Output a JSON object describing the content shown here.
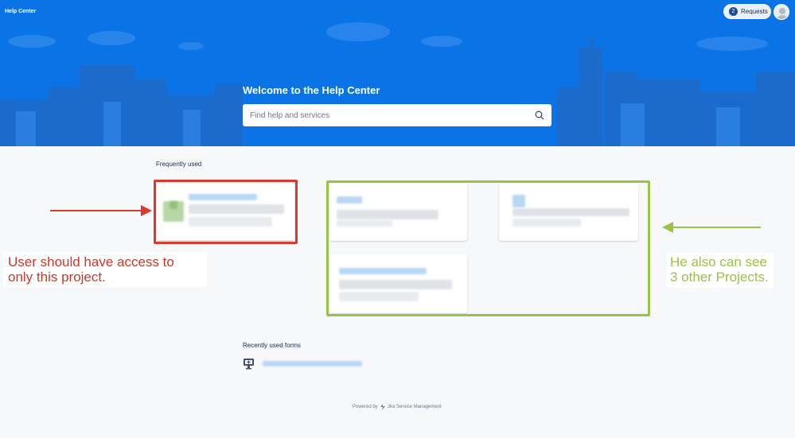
{
  "header": {
    "brand": "Help Center",
    "requests_count": "2",
    "requests_label": "Requests"
  },
  "hero": {
    "welcome": "Welcome to the Help Center",
    "search_placeholder": "Find help and services"
  },
  "sections": {
    "frequently_used": "Frequently used",
    "recently_used_forms": "Recently used forms"
  },
  "annotations": {
    "red": "User should have access to only this project.",
    "green": "He also can see 3 other Projects."
  },
  "footer": {
    "powered_by": "Powered by",
    "product": "Jira Service Management"
  },
  "colors": {
    "hero_blue": "#0a74e6",
    "annotation_red": "#d93a2b",
    "annotation_green": "#9ac246"
  },
  "icons": [
    "search-icon",
    "avatar-icon",
    "form-icon",
    "jira-logo-icon"
  ]
}
